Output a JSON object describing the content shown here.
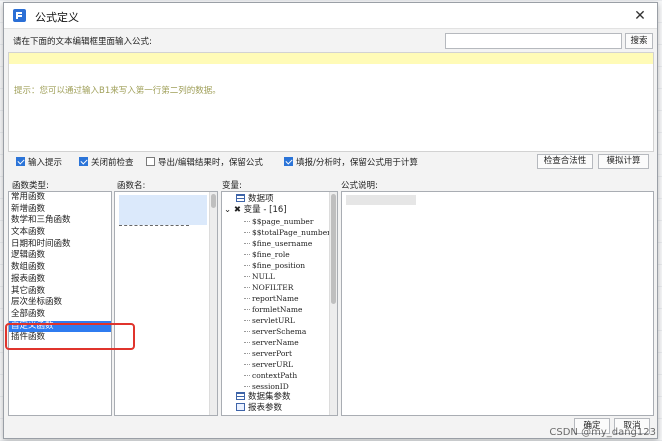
{
  "window": {
    "title": "公式定义",
    "close": "✕"
  },
  "prompt": "请在下面的文本编辑框里面输入公式:",
  "search": {
    "value": "",
    "button": "搜索"
  },
  "editor": {
    "hint": "提示：您可以通过输入B1来写入第一行第二列的数据。"
  },
  "options": {
    "input_hint": {
      "label": "输入提示",
      "checked": true
    },
    "check_before_close": {
      "label": "关闭前检查",
      "checked": true
    },
    "export_keep": {
      "label": "导出/编辑结果时，保留公式",
      "checked": false
    },
    "fill_keep": {
      "label": "填报/分析时，保留公式用于计算",
      "checked": true
    },
    "validate_button": "检查合法性",
    "simulate_button": "模拟计算"
  },
  "columns": {
    "function_type": "函数类型:",
    "function_name": "函数名:",
    "variable": "变量:",
    "description": "公式说明:"
  },
  "function_types": [
    "常用函数",
    "新增函数",
    "数学和三角函数",
    "文本函数",
    "日期和时间函数",
    "逻辑函数",
    "数组函数",
    "报表函数",
    "其它函数",
    "层次坐标函数",
    "全部函数",
    "自定义函数",
    "插件函数"
  ],
  "selected_function_type_index": 11,
  "variables": {
    "data_item": "数据项",
    "variable_group": "变量 - [16]",
    "items": [
      "$$page_number",
      "$$totalPage_number",
      "$fine_username",
      "$fine_role",
      "$fine_position",
      "NULL",
      "NOFILTER",
      "reportName",
      "formletName",
      "servletURL",
      "serverSchema",
      "serverName",
      "serverPort",
      "serverURL",
      "contextPath",
      "sessionID"
    ],
    "dataset_params": "数据集参数",
    "report_params": "报表参数"
  },
  "footer": {
    "ok": "确定",
    "cancel": "取消"
  },
  "watermark": "CSDN @my_dang123"
}
